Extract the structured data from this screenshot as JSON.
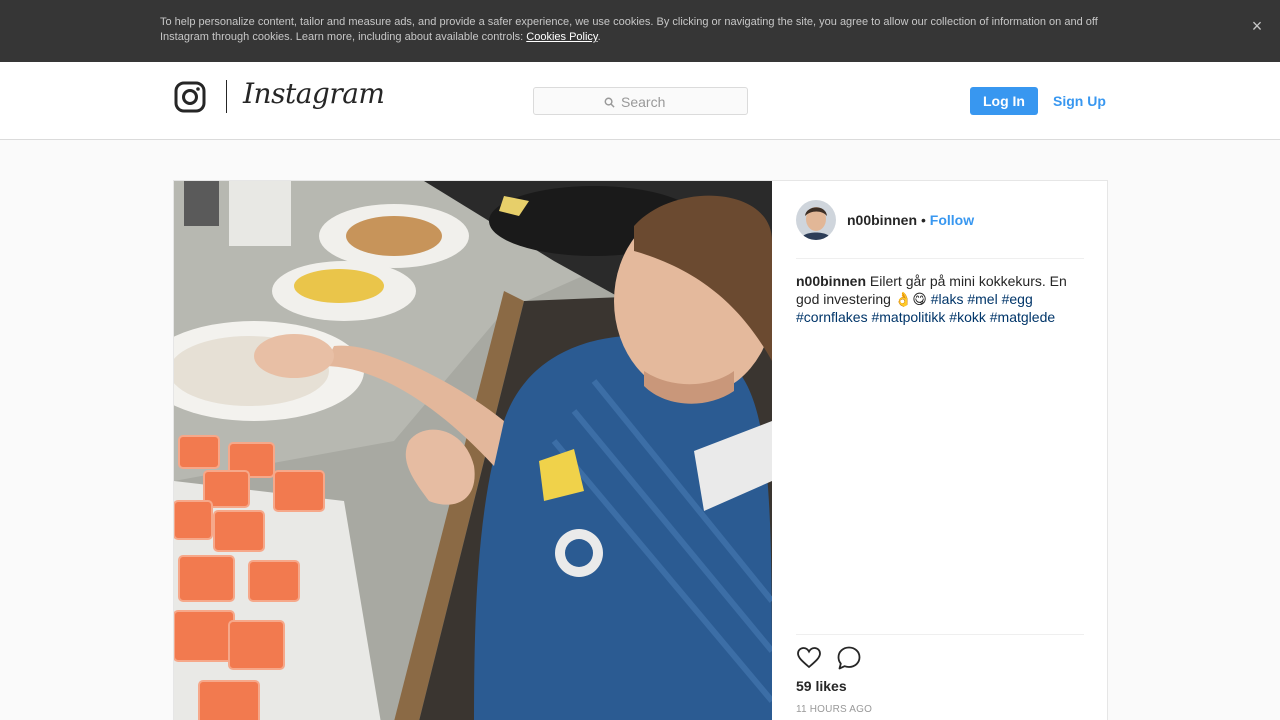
{
  "cookie_banner": {
    "text": "To help personalize content, tailor and measure ads, and provide a safer experience, we use cookies. By clicking or navigating the site, you agree to allow our collection of information on and off Instagram through cookies. Learn more, including about available controls: ",
    "link_label": "Cookies Policy",
    "close_icon": "×"
  },
  "header": {
    "wordmark": "Instagram",
    "search_placeholder": "Search",
    "login_label": "Log In",
    "signup_label": "Sign Up"
  },
  "post": {
    "username": "n00binnen",
    "follow_separator": "•",
    "follow_label": "Follow",
    "caption": {
      "username": "n00binnen",
      "text": "Eilert går på mini kokkekurs. En god investering 👌😋",
      "hashtags": [
        "#laks",
        "#mel",
        "#egg",
        "#cornflakes",
        "#matpolitikk",
        "#kokk",
        "#matglede"
      ]
    },
    "likes": "59 likes",
    "timestamp": "11 HOURS AGO"
  },
  "colors": {
    "accent": "#3897f0",
    "hashtag": "#003569",
    "banner": "#363636"
  },
  "icons": {
    "close": "close-icon",
    "search": "search-icon",
    "like": "heart-icon",
    "comment": "comment-icon",
    "logo": "instagram-glyph-icon"
  }
}
